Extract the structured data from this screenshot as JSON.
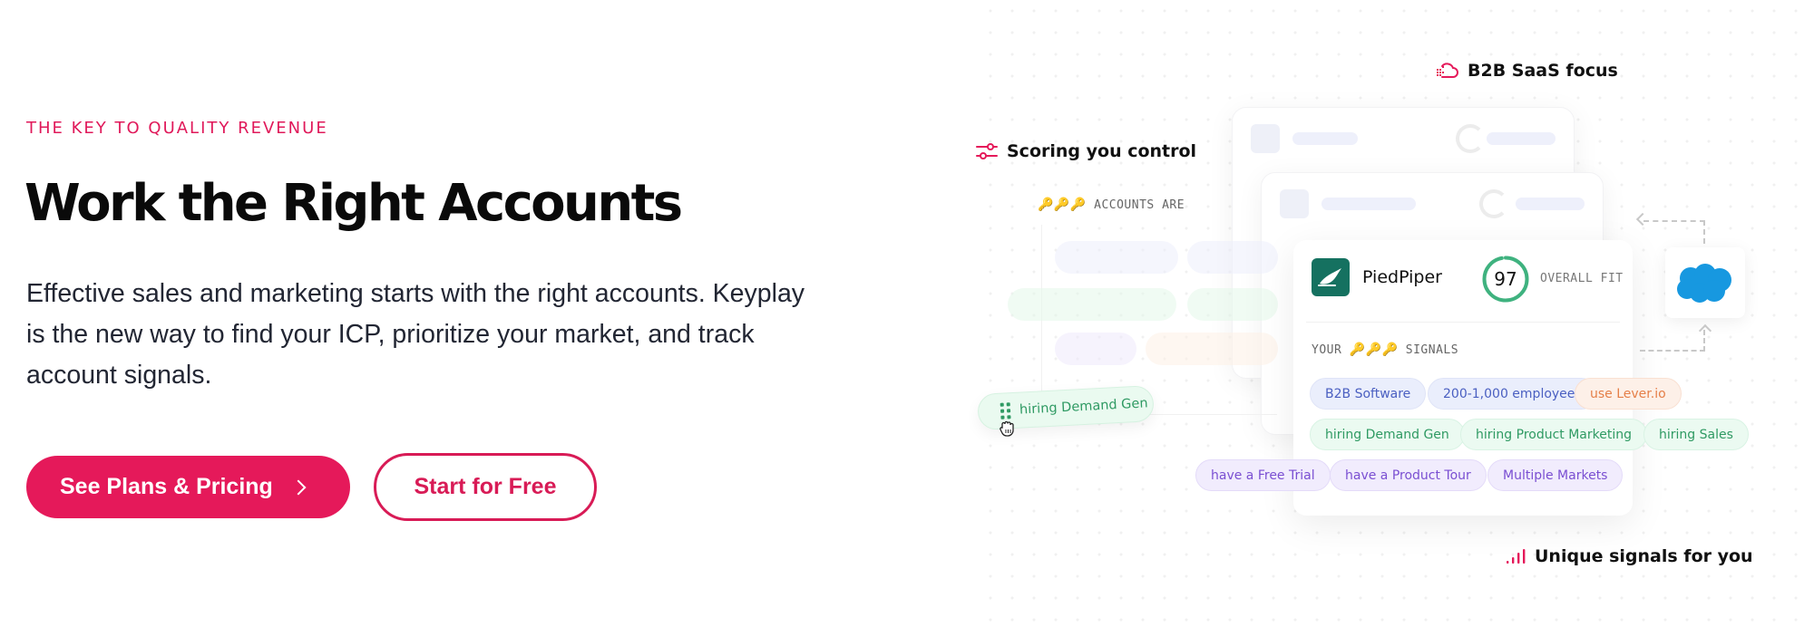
{
  "hero": {
    "eyebrow": "THE KEY TO QUALITY REVENUE",
    "title": "Work the Right Accounts",
    "lead": "Effective sales and marketing starts with the right accounts. Keyplay is the new way to find your ICP, prioritize your market, and track account signals.",
    "primary_button": "See Plans & Pricing",
    "secondary_button": "Start for Free"
  },
  "illustration": {
    "features": {
      "b2b": "B2B SaaS focus",
      "scoring": "Scoring you control",
      "signals": "Unique signals for you"
    },
    "accounts_keys": "🔑🔑🔑",
    "accounts_label": "ACCOUNTS ARE",
    "drag_pill": "hiring Demand Gen",
    "card": {
      "company": "PiedPiper",
      "score": "97",
      "score_fraction": 0.97,
      "fit_label": "OVERALL FIT",
      "signals_prefix": "YOUR",
      "signals_keys": "🔑🔑🔑",
      "signals_suffix": "SIGNALS",
      "pills": [
        {
          "label": "B2B Software",
          "color": "blue"
        },
        {
          "label": "200-1,000 employees",
          "color": "blue"
        },
        {
          "label": "use Lever.io",
          "color": "orange"
        },
        {
          "label": "hiring Demand Gen",
          "color": "green"
        },
        {
          "label": "hiring Product Marketing",
          "color": "green"
        },
        {
          "label": "hiring Sales",
          "color": "green"
        },
        {
          "label": "have a Free Trial",
          "color": "purple"
        },
        {
          "label": "have a Product Tour",
          "color": "purple"
        },
        {
          "label": "Multiple Markets",
          "color": "purple"
        }
      ]
    },
    "integration_logo": "salesforce-cloud"
  },
  "colors": {
    "brand": "#e5195a",
    "logo_green": "#157160",
    "salesforce_blue": "#1798c1",
    "score_green": "#3fb27f"
  }
}
